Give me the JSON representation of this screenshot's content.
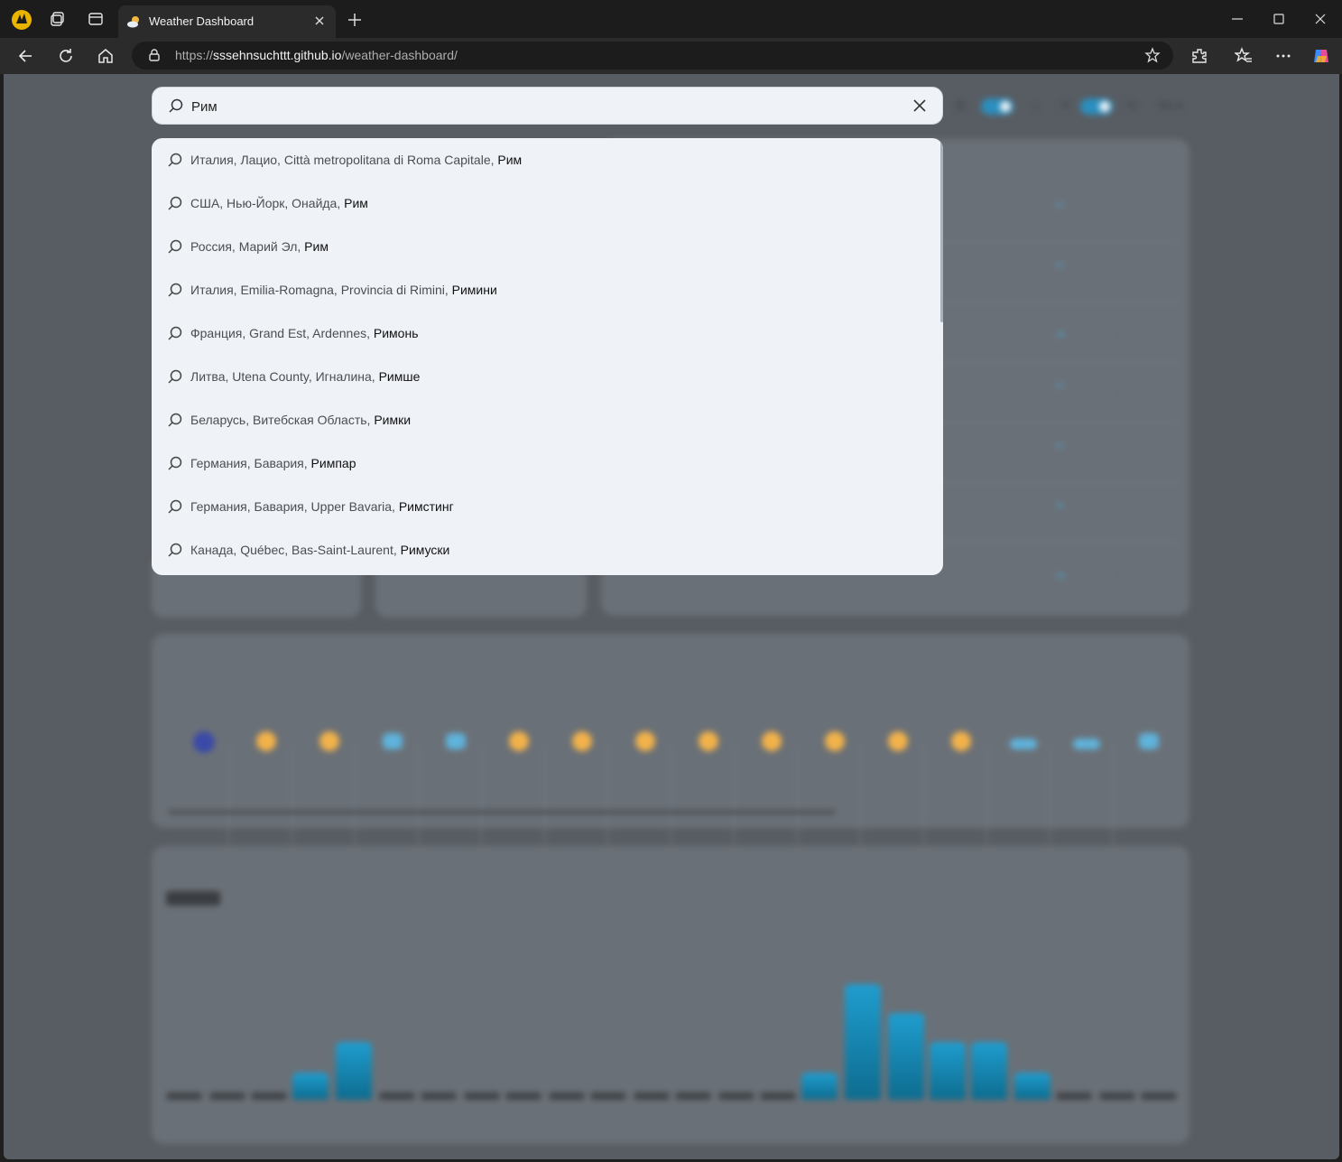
{
  "browser": {
    "tab_title": "Weather Dashboard",
    "url_prefix": "https://",
    "url_host": "sssehnsuchttt.github.io",
    "url_path": "/weather-dashboard/"
  },
  "search": {
    "value": "Рим",
    "results": [
      {
        "prefix": "Италия, Лацио, Città metropolitana di Roma Capitale, ",
        "name": "Рим"
      },
      {
        "prefix": "США, Нью-Йорк, Онайда, ",
        "name": "Рим"
      },
      {
        "prefix": "Россия, Марий Эл, ",
        "name": "Рим"
      },
      {
        "prefix": "Италия, Emilia-Romagna, Provincia di Rimini, ",
        "name": "Римини"
      },
      {
        "prefix": "Франция, Grand Est, Ardennes, ",
        "name": "Римонь"
      },
      {
        "prefix": "Литва, Utena County, Игналина, ",
        "name": "Римше"
      },
      {
        "prefix": "Беларусь, Витебская Область, ",
        "name": "Римки"
      },
      {
        "prefix": "Германия, Бавария, ",
        "name": "Римпар"
      },
      {
        "prefix": "Германия, Бавария, Upper Bavaria, ",
        "name": "Римстинг"
      },
      {
        "prefix": "Канада, Québec, Bas-Saint-Laurent, ",
        "name": "Римуски"
      }
    ]
  },
  "colors": {
    "accent": "#1f9dcf",
    "page_bg": "#585d63",
    "card_bg": "#6a7077",
    "dropdown_bg": "#eff2f6"
  }
}
